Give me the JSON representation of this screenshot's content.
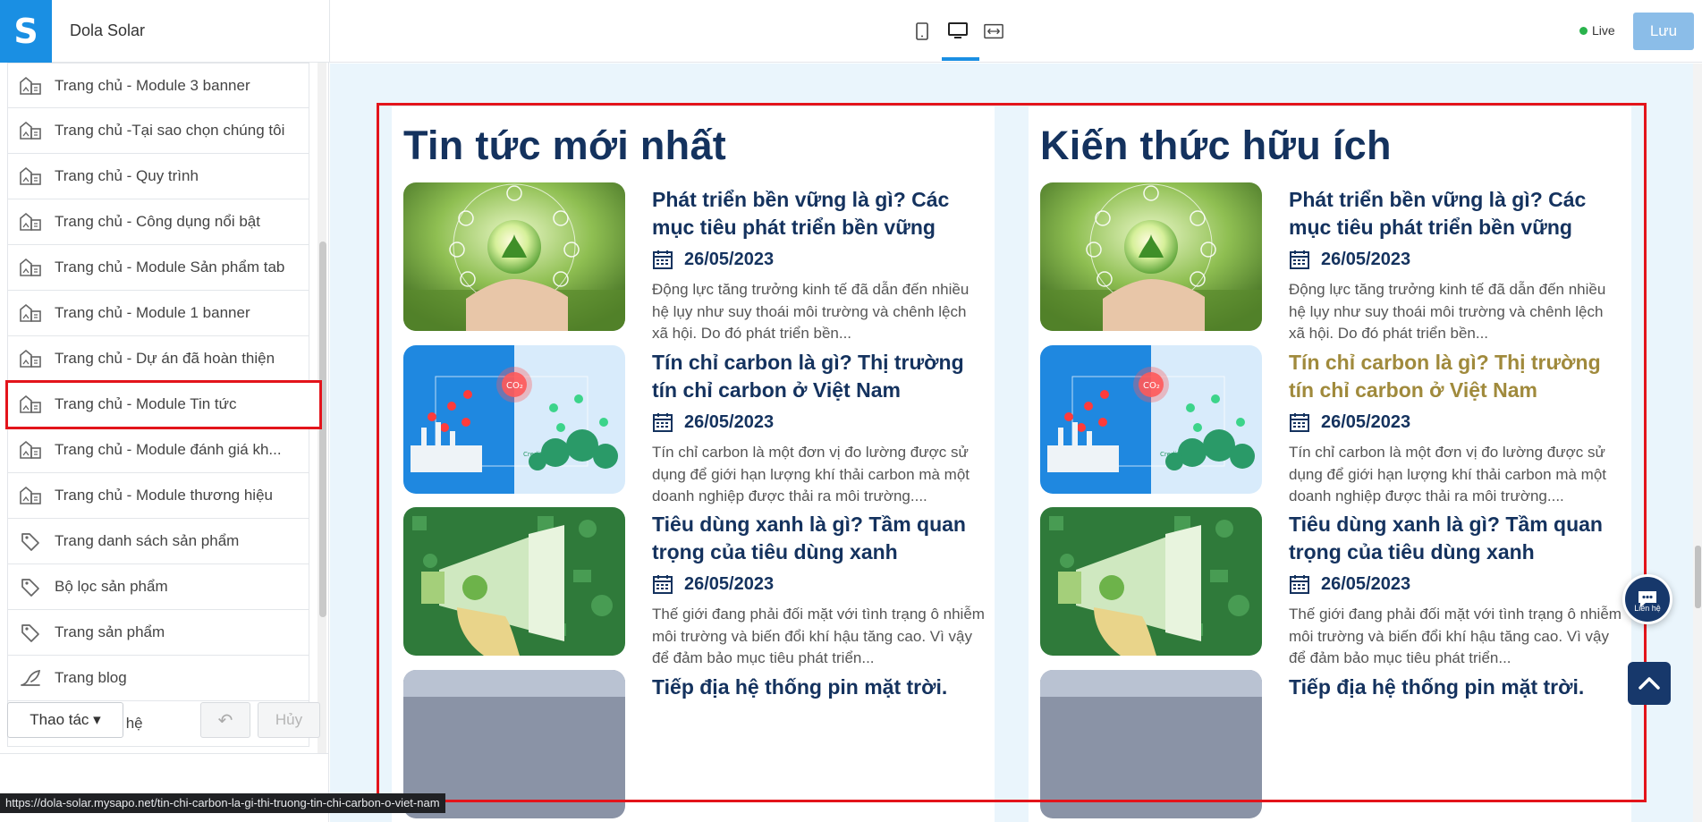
{
  "app": {
    "logo_letter": "S",
    "name": "Dola Solar"
  },
  "toolbar": {
    "live_label": "Live",
    "save_label": "Lưu"
  },
  "sidebar": {
    "items": [
      {
        "label": "Trang chủ - Module 3 banner",
        "icon": "layout-icon"
      },
      {
        "label": "Trang chủ -Tại sao chọn chúng tôi",
        "icon": "layout-icon"
      },
      {
        "label": "Trang chủ - Quy trình",
        "icon": "layout-icon"
      },
      {
        "label": "Trang chủ - Công dụng nổi bật",
        "icon": "layout-icon"
      },
      {
        "label": "Trang chủ - Module Sản phẩm tab",
        "icon": "layout-icon"
      },
      {
        "label": "Trang chủ - Module 1 banner",
        "icon": "layout-icon"
      },
      {
        "label": "Trang chủ - Dự án đã hoàn thiện",
        "icon": "layout-icon"
      },
      {
        "label": "Trang chủ - Module Tin tức",
        "icon": "layout-icon",
        "selected": true
      },
      {
        "label": "Trang chủ - Module đánh giá kh...",
        "icon": "layout-icon"
      },
      {
        "label": "Trang chủ - Module thương hiệu",
        "icon": "layout-icon"
      },
      {
        "label": "Trang danh sách sản phẩm",
        "icon": "tag-icon"
      },
      {
        "label": "Bộ lọc sản phẩm",
        "icon": "tag-icon"
      },
      {
        "label": "Trang sản phẩm",
        "icon": "tag-icon"
      },
      {
        "label": "Trang blog",
        "icon": "blog-icon"
      },
      {
        "label": "Trang liên hệ",
        "icon": "blog-icon"
      }
    ],
    "actions_label": "Thao tác",
    "cancel_label": "Hủy"
  },
  "status_url": "https://dola-solar.mysapo.net/tin-chi-carbon-la-gi-thi-truong-tin-chi-carbon-o-viet-nam",
  "preview": {
    "left_heading": "Tin tức mới nhất",
    "right_heading": "Kiến thức hữu ích",
    "articles": [
      {
        "title": "Phát triển bền vững là gì? Các mục tiêu phát triển bền vững",
        "date": "26/05/2023",
        "desc": "Động lực tăng trưởng kinh tế đã dẫn đến nhiều hệ lụy như suy thoái môi trường và chênh lệch xã hội. Do đó phát triển bền..."
      },
      {
        "title": "Tín chỉ carbon là gì? Thị trường tín chỉ carbon ở Việt Nam",
        "date": "26/05/2023",
        "desc": "Tín chỉ carbon là một đơn vị đo lường được sử dụng để giới hạn lượng khí thải carbon mà một doanh nghiệp được thải ra môi trường...."
      },
      {
        "title": "Tiêu dùng xanh là gì? Tầm quan trọng của tiêu dùng xanh",
        "date": "26/05/2023",
        "desc": "Thế giới đang phải đối mặt với tình trạng ô nhiễm môi trường và biến đổi khí hậu tăng cao. Vì vậy để đảm bảo mục tiêu phát triển..."
      },
      {
        "title": "Tiếp địa hệ thống pin mặt trời.",
        "date": "",
        "desc": ""
      }
    ],
    "co2_label": "CO₂",
    "credits_label": "Credits",
    "chat_label": "Liên hệ"
  }
}
